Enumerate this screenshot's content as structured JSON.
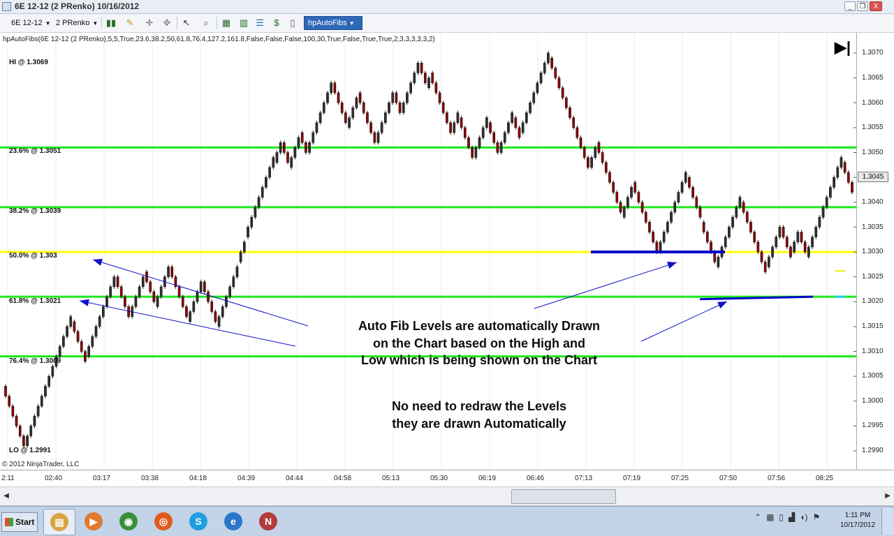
{
  "window": {
    "title": "6E 12-12 (2 PRenko)  10/16/2012",
    "buttons": {
      "minimize": "_",
      "restore": "❐",
      "close": "X"
    }
  },
  "toolbar": {
    "instrument": "6E 12-12",
    "bar_type": "2 PRenko",
    "active_indicator": "hpAutoFibs",
    "icons": [
      "bar-style-icon",
      "pen-tool-icon",
      "crosshair-icon",
      "cursor-icon",
      "magnifier-icon",
      "data-box-icon",
      "properties-icon",
      "chart-trader-icon",
      "strategy-icon",
      "order-icon",
      "panel-icon"
    ]
  },
  "chart": {
    "indicator_params": "hpAutoFibs(6E 12-12 (2 PRenko),5,5,True,23.6,38.2,50,61.8,76.4,127.2,161.8,False,False,False,100,30,True,False,True,True,2,3,3,3,3,3,2)",
    "hi_label": "HI @ 1.3069",
    "lo_label": "LO @ 1.2991",
    "levels": [
      {
        "label": "23.6% @ 1.3051",
        "price": 1.3051,
        "color": "#1ee81e"
      },
      {
        "label": "38.2% @ 1.3039",
        "price": 1.3039,
        "color": "#1ee81e"
      },
      {
        "label": "50.0% @ 1.303",
        "price": 1.303,
        "color": "#ffff00"
      },
      {
        "label": "61.8% @ 1.3021",
        "price": 1.3021,
        "color": "#1ee81e"
      },
      {
        "label": "76.4% @ 1.3009",
        "price": 1.3009,
        "color": "#1ee81e"
      }
    ],
    "current_price": "1.3045",
    "copyright": "© 2012 NinjaTrader, LLC",
    "annotation_1": [
      "Auto Fib Levels are automatically Drawn",
      "on the Chart based on the High and",
      "Low which is being shown on the Chart"
    ],
    "annotation_2": [
      "No need to redraw the Levels",
      "they are drawn Automatically"
    ],
    "y_axis": [
      "1.3070",
      "1.3065",
      "1.3060",
      "1.3055",
      "1.3050",
      "1.3045",
      "1.3040",
      "1.3035",
      "1.3030",
      "1.3025",
      "1.3020",
      "1.3015",
      "1.3010",
      "1.3005",
      "1.3000",
      "1.2995",
      "1.2990"
    ],
    "x_axis": [
      "2:11",
      "02:40",
      "03:17",
      "03:38",
      "04:18",
      "04:39",
      "04:44",
      "04:58",
      "05:13",
      "05:30",
      "06:19",
      "06:46",
      "07:13",
      "07:19",
      "07:25",
      "07:50",
      "07:56",
      "08:25"
    ],
    "colors": {
      "up_bar": "#3a3a3a",
      "down_bar": "#8b0000",
      "arrow": "#1010c8",
      "hline": "#0000cc"
    }
  },
  "chart_data": {
    "type": "renko",
    "brick_size": 0.0002,
    "ylim": [
      1.2986,
      1.3072
    ],
    "path": [
      1.3003,
      1.2991,
      1.3016,
      1.3009,
      1.3025,
      1.3017,
      1.3026,
      1.3019,
      1.3027,
      1.3016,
      1.3024,
      1.3015,
      1.3028,
      1.3033,
      1.3048,
      1.3052,
      1.3047,
      1.3054,
      1.305,
      1.3064,
      1.3055,
      1.3062,
      1.3052,
      1.3062,
      1.3058,
      1.3068,
      1.3063,
      1.3066,
      1.3054,
      1.3057,
      1.3049,
      1.3056,
      1.305,
      1.3057,
      1.3054,
      1.3069,
      1.3051,
      1.3049,
      1.3047,
      1.3052,
      1.3037,
      1.3044,
      1.303,
      1.3045,
      1.3036,
      1.3032,
      1.3027,
      1.304,
      1.3027,
      1.3035,
      1.303,
      1.3034,
      1.3029,
      1.3048,
      1.3042
    ],
    "hi": 1.3069,
    "lo": 1.2991,
    "fib_levels": [
      {
        "name": "23.6%",
        "value": 1.3051
      },
      {
        "name": "38.2%",
        "value": 1.3039
      },
      {
        "name": "50.0%",
        "value": 1.303
      },
      {
        "name": "61.8%",
        "value": 1.3021
      },
      {
        "name": "76.4%",
        "value": 1.3009
      }
    ],
    "grid": true
  },
  "taskbar": {
    "start_label": "Start",
    "apps": [
      {
        "name": "explorer",
        "glyph": "▤",
        "color": "#d9a441"
      },
      {
        "name": "media",
        "glyph": "▶",
        "color": "#e07a2c"
      },
      {
        "name": "chrome",
        "glyph": "◉",
        "color": "#3b8f3b"
      },
      {
        "name": "firefox",
        "glyph": "◎",
        "color": "#e05a1e"
      },
      {
        "name": "skype",
        "glyph": "S",
        "color": "#1e9ee0"
      },
      {
        "name": "ie",
        "glyph": "e",
        "color": "#2a76c9"
      },
      {
        "name": "ninjatrader",
        "glyph": "N",
        "color": "#b23b3b"
      }
    ],
    "time": "1:11 PM",
    "date": "10/17/2012"
  }
}
